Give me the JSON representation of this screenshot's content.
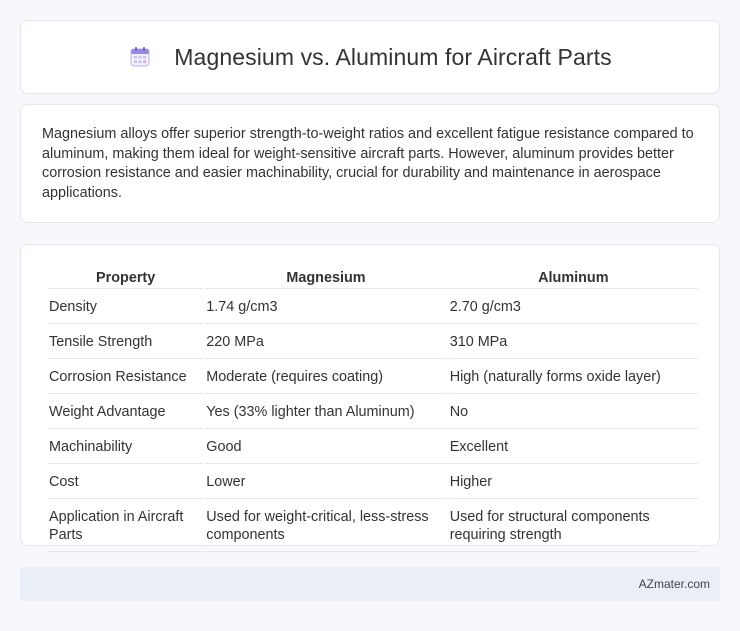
{
  "header": {
    "title": "Magnesium vs. Aluminum for Aircraft Parts",
    "icon": "calendar-icon"
  },
  "summary": {
    "text": "Magnesium alloys offer superior strength-to-weight ratios and excellent fatigue resistance compared to aluminum, making them ideal for weight-sensitive aircraft parts. However, aluminum provides better corrosion resistance and easier machinability, crucial for durability and maintenance in aerospace applications."
  },
  "table": {
    "headers": [
      "Property",
      "Magnesium",
      "Aluminum"
    ],
    "rows": [
      [
        "Density",
        "1.74 g/cm3",
        "2.70 g/cm3"
      ],
      [
        "Tensile Strength",
        "220 MPa",
        "310 MPa"
      ],
      [
        "Corrosion Resistance",
        "Moderate (requires coating)",
        "High (naturally forms oxide layer)"
      ],
      [
        "Weight Advantage",
        "Yes (33% lighter than Aluminum)",
        "No"
      ],
      [
        "Machinability",
        "Good",
        "Excellent"
      ],
      [
        "Cost",
        "Lower",
        "Higher"
      ],
      [
        "Application in Aircraft Parts",
        "Used for weight-critical, less-stress components",
        "Used for structural components requiring strength"
      ]
    ]
  },
  "footer": {
    "brand": "AZmater.com"
  },
  "colors": {
    "background": "#f7f8fb",
    "card_border": "#e3e6ec",
    "footer_bg": "#e9eef7",
    "icon_accent": "#9b8be0"
  }
}
